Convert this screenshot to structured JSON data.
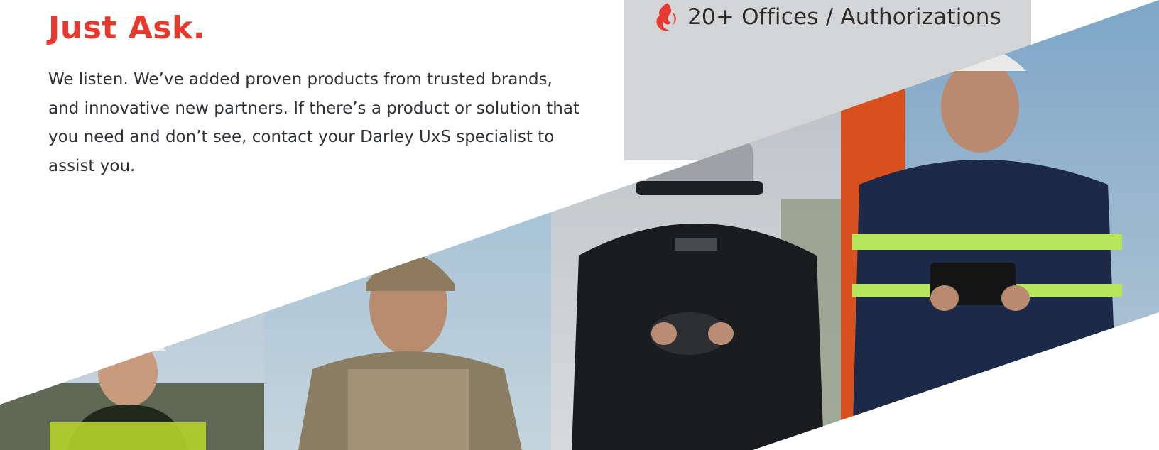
{
  "colors": {
    "accent": "#e8392f",
    "panel": "#d3d4d6",
    "text": "#2f3236"
  },
  "headline": "Just Ask.",
  "body": "We listen. We’ve added proven products from trusted brands, and innovative new partners. If there’s a product or solution that you need and don’t see, contact your Darley UxS specialist to assist you.",
  "stat": {
    "icon": "flame-icon",
    "text": "20+ Offices / Authorizations"
  },
  "photos": [
    {
      "subject": "construction-worker-hi-vis-white-helmet"
    },
    {
      "subject": "soldier-combat-helmet-camo"
    },
    {
      "subject": "bomb-disposal-suit-controller"
    },
    {
      "subject": "firefighter-reflective-jacket-tablet"
    }
  ]
}
